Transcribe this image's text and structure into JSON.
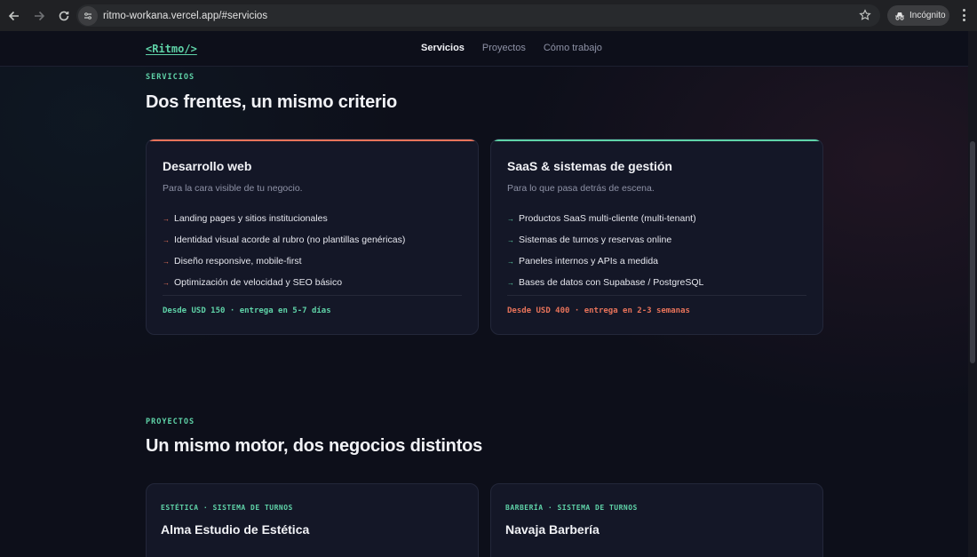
{
  "browser": {
    "url": "ritmo-workana.vercel.app/#servicios",
    "incognito_label": "Incógnito"
  },
  "nav": {
    "logo": "<Ritmo/>",
    "links": [
      "Servicios",
      "Proyectos",
      "Cómo trabajo"
    ]
  },
  "servicios": {
    "eyebrow": "SERVICIOS",
    "title": "Dos frentes, un mismo criterio",
    "cards": [
      {
        "title": "Desarrollo web",
        "subtitle": "Para la cara visible de tu negocio.",
        "items": [
          "Landing pages y sitios institucionales",
          "Identidad visual acorde al rubro (no plantillas genéricas)",
          "Diseño responsive, mobile-first",
          "Optimización de velocidad y SEO básico"
        ],
        "price": "Desde USD 150 · entrega en 5-7 días",
        "accent": "#e8735a",
        "price_color": "#5fd3a8"
      },
      {
        "title": "SaaS & sistemas de gestión",
        "subtitle": "Para lo que pasa detrás de escena.",
        "items": [
          "Productos SaaS multi-cliente (multi-tenant)",
          "Sistemas de turnos y reservas online",
          "Paneles internos y APIs a medida",
          "Bases de datos con Supabase / PostgreSQL"
        ],
        "price": "Desde USD 400 · entrega en 2-3 semanas",
        "accent": "#5fd3a8",
        "price_color": "#e8735a"
      }
    ]
  },
  "proyectos": {
    "eyebrow": "PROYECTOS",
    "title": "Un mismo motor, dos negocios distintos",
    "cards": [
      {
        "tag": "ESTÉTICA · SISTEMA DE TURNOS",
        "title": "Alma Estudio de Estética"
      },
      {
        "tag": "BARBERÍA · SISTEMA DE TURNOS",
        "title": "Navaja Barbería"
      }
    ]
  }
}
